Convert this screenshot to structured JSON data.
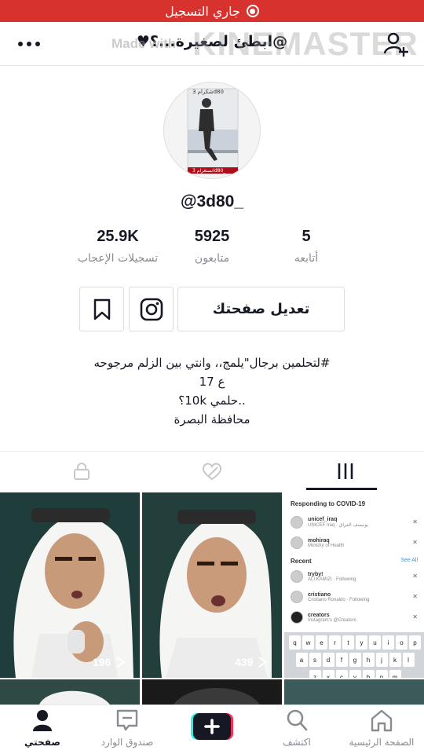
{
  "status_bar": {
    "recording_label": "جاري التسجيل"
  },
  "header": {
    "title": "@ابطئ لصغيرة...؟♥",
    "watermark_main": "KINEMASTER",
    "watermark_small": "Made with"
  },
  "profile": {
    "avatar_caption_top": "شكرام 3d80",
    "avatar_caption_bottom": "انستغرام 3d80_",
    "username": "@3d80_",
    "stats": [
      {
        "value": "25.9K",
        "label": "تسجيلات الإعجاب"
      },
      {
        "value": "5925",
        "label": "متابعون"
      },
      {
        "value": "5",
        "label": "أتابعه"
      }
    ],
    "edit_button": "تعديل صفحتك",
    "bio_lines": [
      "#لتحلمين برجال\"يلمج،، وانتي بين الزلم مرجوحه",
      "ع 17",
      "..حلمي 10k؟",
      "محافظة البصرة"
    ]
  },
  "videos": [
    {
      "views": "196"
    },
    {
      "views": "439"
    },
    {
      "views": ""
    }
  ],
  "screenshot_overlay": {
    "heading": "Responding to COVID-19",
    "rows": [
      {
        "name": "unicef_iraq",
        "sub": "UNICEF Iraq · يونيسف العراق"
      },
      {
        "name": "mohiraq",
        "sub": "Ministry of Health"
      }
    ],
    "recent_label": "Recent",
    "see_all": "See All",
    "recent_rows": [
      {
        "name": "tryby!",
        "sub": "ALI KAMIZI · Following"
      },
      {
        "name": "cristiano",
        "sub": "Cristiano Ronaldo · Following"
      },
      {
        "name": "creators",
        "sub": "Instagram's @Creators"
      }
    ],
    "keyboard_rows": [
      [
        "q",
        "w",
        "e",
        "r",
        "t",
        "y",
        "u",
        "i",
        "o",
        "p"
      ],
      [
        "a",
        "s",
        "d",
        "f",
        "g",
        "h",
        "j",
        "k",
        "l"
      ],
      [
        "z",
        "x",
        "c",
        "v",
        "b",
        "n",
        "m"
      ]
    ]
  },
  "bottom_nav": [
    {
      "label": "صفحتي",
      "active": true
    },
    {
      "label": "صندوق الوارد"
    },
    {
      "label": ""
    },
    {
      "label": "اكتشف"
    },
    {
      "label": "الصفحة الرئيسية"
    }
  ],
  "colors": {
    "recording": "#d8322e",
    "text": "#161823",
    "muted": "#8a8b91"
  }
}
